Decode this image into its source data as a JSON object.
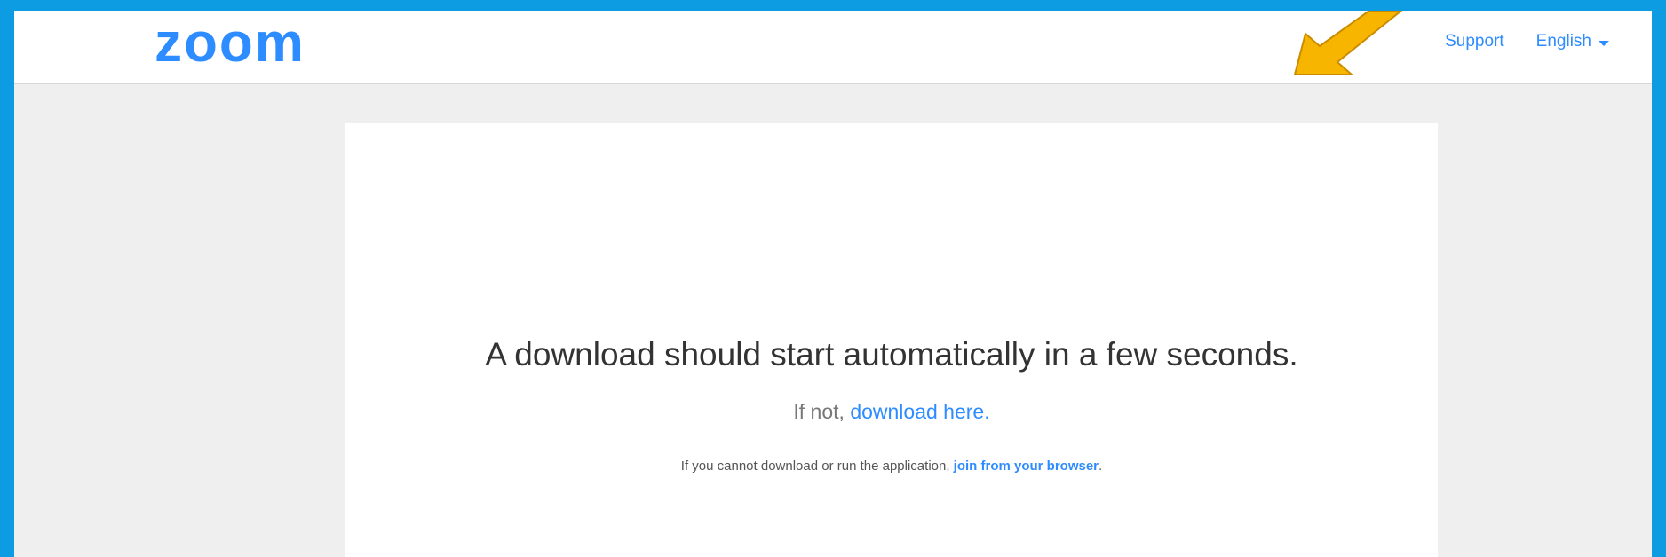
{
  "header": {
    "logo_text": "zoom",
    "nav": {
      "support_label": "Support",
      "language_label": "English"
    }
  },
  "main": {
    "headline": "A download should start automatically in a few seconds.",
    "subline_prefix": "If not, ",
    "subline_link": "download here.",
    "note_prefix": "If you cannot download or run the application, ",
    "note_link": "join from your browser",
    "note_suffix": "."
  },
  "colors": {
    "frame_border": "#0d9be2",
    "brand_blue": "#2d8cff",
    "arrow_fill": "#f7b500"
  }
}
